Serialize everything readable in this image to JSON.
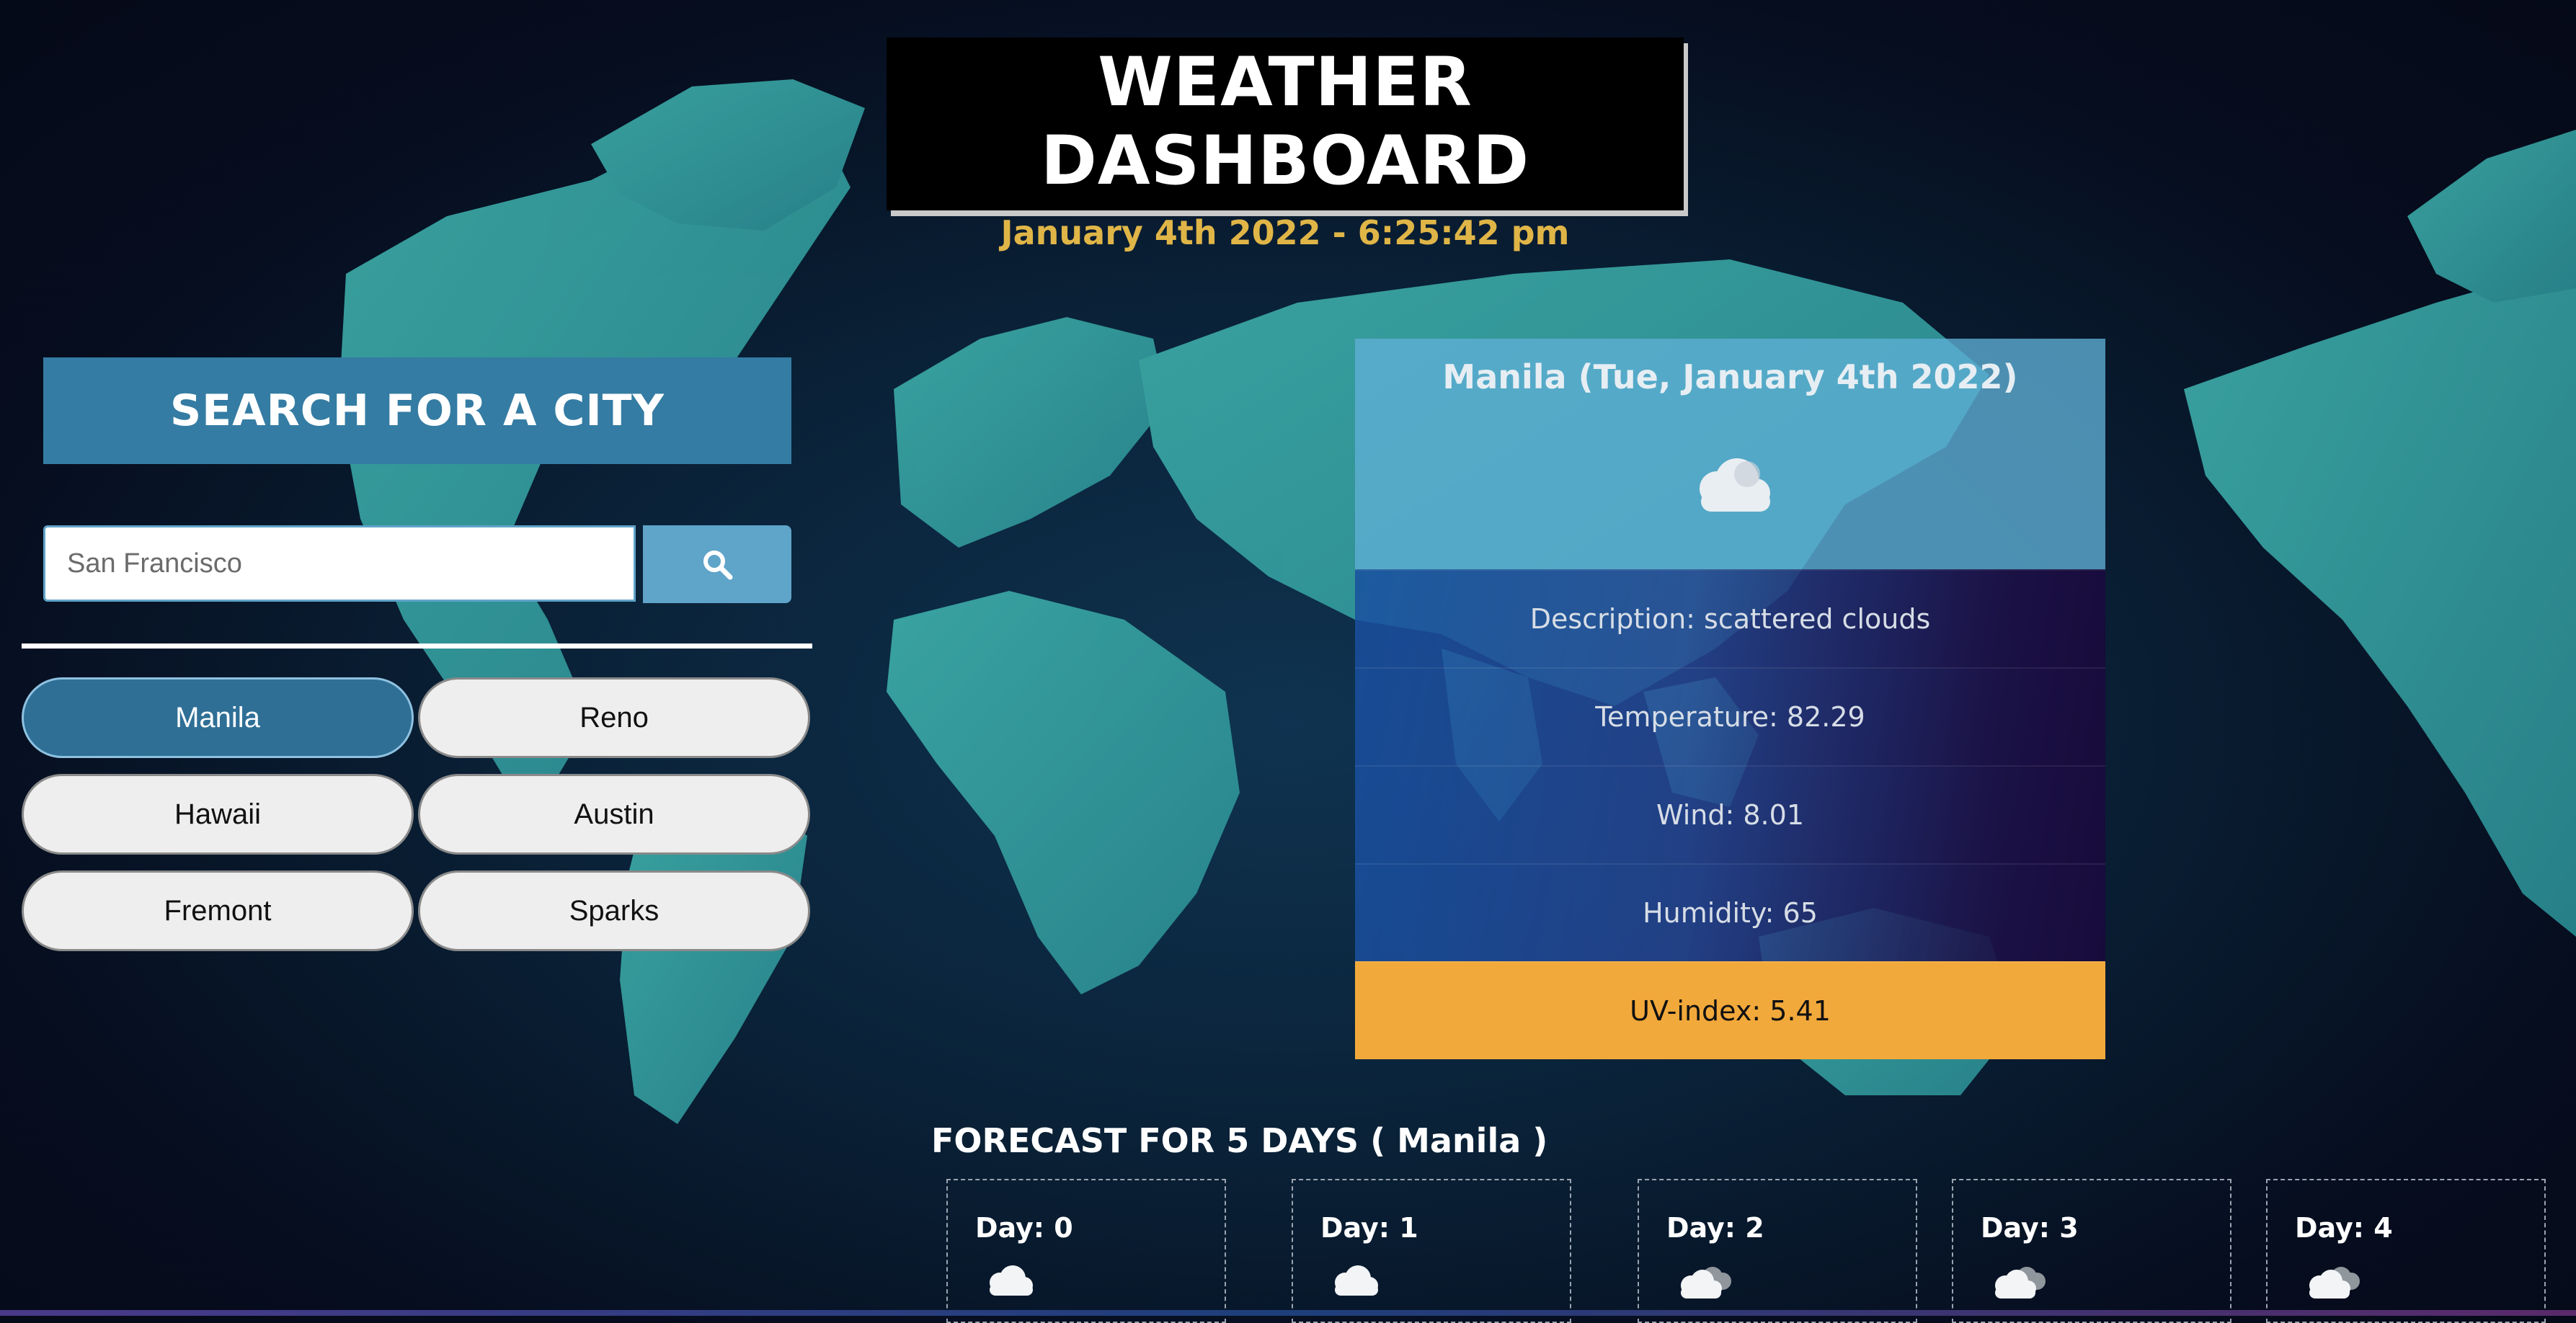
{
  "header": {
    "title": "WEATHER DASHBOARD",
    "datetime": "January 4th 2022 - 6:25:42 pm"
  },
  "search": {
    "title": "SEARCH FOR A CITY",
    "placeholder": "San Francisco",
    "button_icon": "search-icon"
  },
  "cities": [
    {
      "label": "Manila",
      "active": true
    },
    {
      "label": "Reno",
      "active": false
    },
    {
      "label": "Hawaii",
      "active": false
    },
    {
      "label": "Austin",
      "active": false
    },
    {
      "label": "Fremont",
      "active": false
    },
    {
      "label": "Sparks",
      "active": false
    }
  ],
  "current": {
    "city_date": "Manila (Tue, January 4th 2022)",
    "icon": "scattered-clouds-icon",
    "description": "Description: scattered clouds",
    "temperature": "Temperature: 82.29",
    "wind": "Wind: 8.01",
    "humidity": "Humidity: 65",
    "uv": "UV-index: 5.41"
  },
  "forecast": {
    "title": "FORECAST FOR 5 DAYS ( Manila )",
    "days": [
      {
        "label": "Day: 0",
        "icon": "cloud-icon"
      },
      {
        "label": "Day: 1",
        "icon": "cloud-icon"
      },
      {
        "label": "Day: 2",
        "icon": "broken-clouds-icon"
      },
      {
        "label": "Day: 3",
        "icon": "broken-clouds-icon"
      },
      {
        "label": "Day: 4",
        "icon": "broken-clouds-icon"
      }
    ]
  },
  "colors": {
    "accent": "#347ca3",
    "search_button": "#5fa4c9",
    "datetime": "#e0b547",
    "uv": "#f2a93b"
  }
}
